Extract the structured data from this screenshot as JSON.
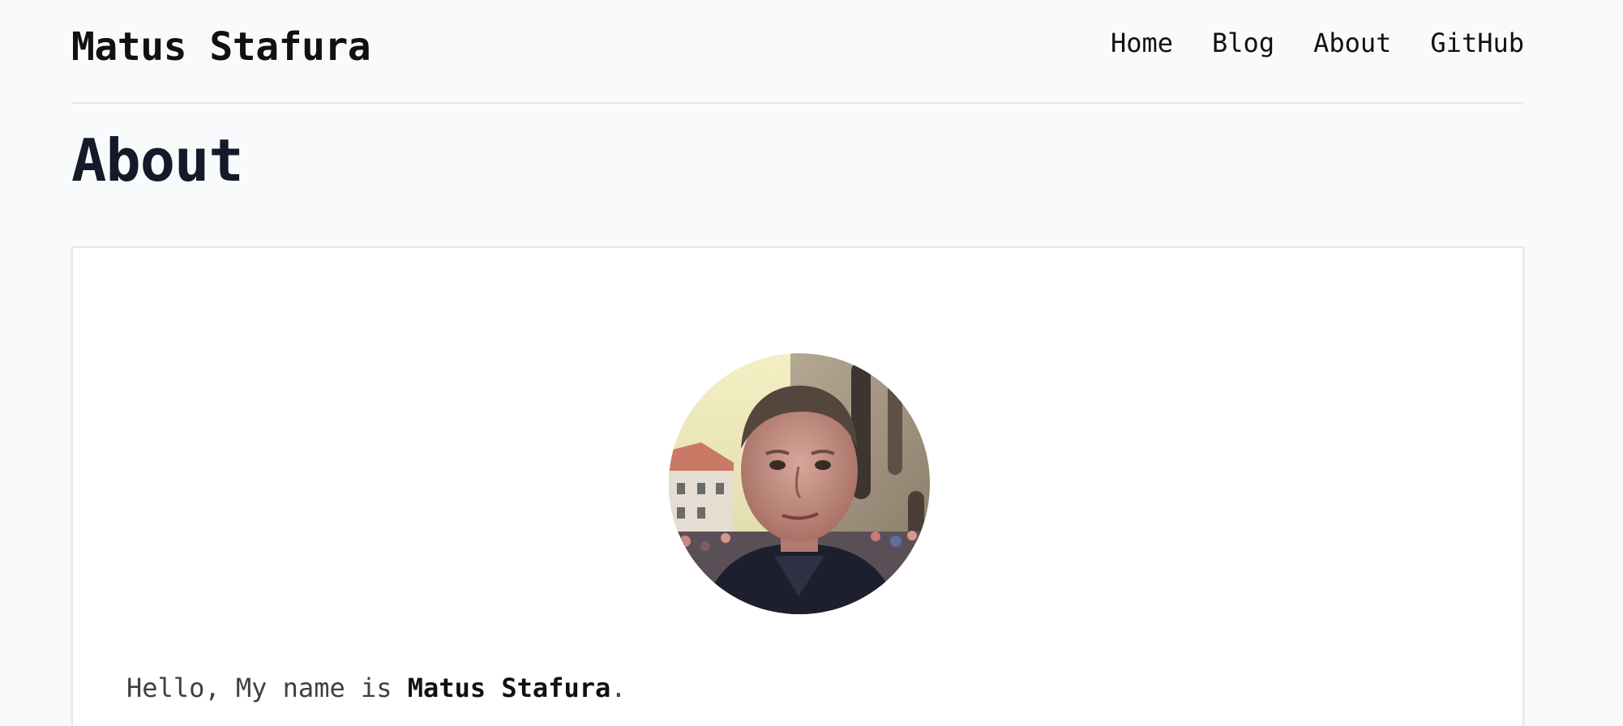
{
  "header": {
    "site_title": "Matus Stafura",
    "nav": [
      {
        "label": "Home"
      },
      {
        "label": "Blog"
      },
      {
        "label": "About"
      },
      {
        "label": "GitHub"
      }
    ]
  },
  "main": {
    "heading": "About",
    "profile": {
      "avatar_icon": "profile-photo",
      "intro_prefix": "Hello, My name is ",
      "name": "Matus Stafura",
      "intro_suffix": "."
    }
  },
  "colors": {
    "page_bg": "#f9fafb",
    "card_bg": "#ffffff",
    "text_dark": "#111111",
    "heading": "#141a2a",
    "divider": "#e5e7eb"
  }
}
